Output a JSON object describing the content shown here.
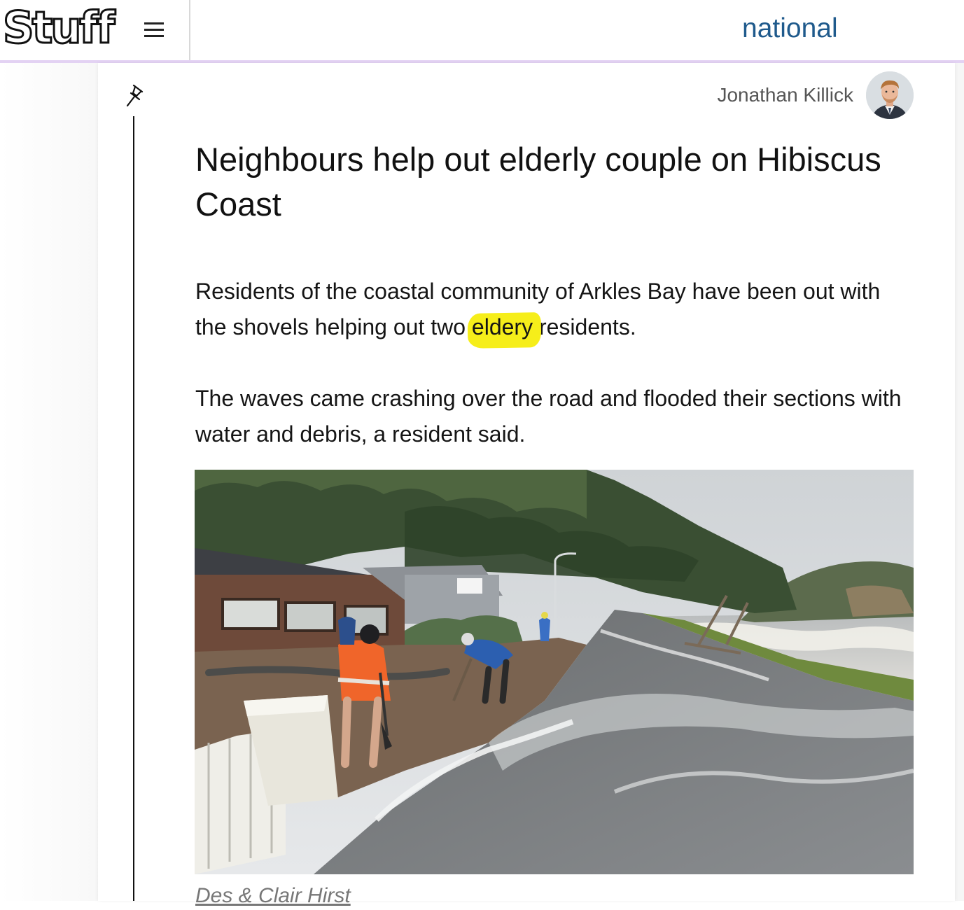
{
  "header": {
    "logo_text": "Stuff",
    "menu_icon": "hamburger-menu-icon",
    "section": "national"
  },
  "post": {
    "pinned_icon": "pin-icon",
    "author": "Jonathan Killick",
    "headline": "Neighbours help out elderly couple on Hibiscus Coast",
    "paragraph1": {
      "before": "Residents of the coastal community of Arkles Bay have been out with the shovels helping out two ",
      "highlighted": "eldery",
      "after": " residents."
    },
    "paragraph2": "The waves came crashing over the road and flooded their sections with water and debris, a resident said.",
    "photo_caption": "Des & Clair Hirst"
  },
  "colors": {
    "section_link": "#1f5a8c",
    "header_underline": "#e3d2f3",
    "highlight": "#f6ee1a"
  }
}
